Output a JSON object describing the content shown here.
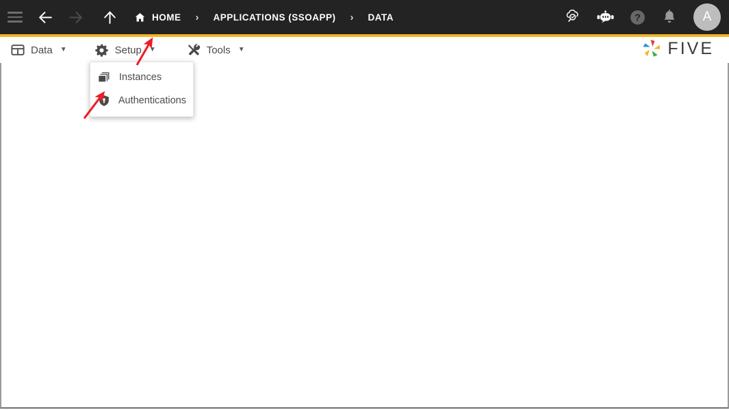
{
  "topbar": {
    "menu_button": "menu",
    "back_button": "back",
    "forward_button": "forward",
    "up_button": "up",
    "breadcrumbs": [
      {
        "label": "HOME",
        "icon": "home-icon"
      },
      {
        "label": "APPLICATIONS (SSOAPP)",
        "icon": ""
      },
      {
        "label": "DATA",
        "icon": ""
      }
    ],
    "separator": "›",
    "actions": [
      {
        "name": "cloud-search-icon",
        "title": "cloud-search"
      },
      {
        "name": "chatbot-icon",
        "title": "chatbot"
      },
      {
        "name": "help-icon",
        "title": "help",
        "glyph": "?"
      },
      {
        "name": "notifications-bell-icon",
        "title": "notifications"
      }
    ],
    "avatar_initial": "A"
  },
  "menubar": {
    "items": [
      {
        "label": "Data",
        "icon": "table-grid-icon",
        "caret": "▼"
      },
      {
        "label": "Setup",
        "icon": "gear-icon",
        "caret": "▼"
      },
      {
        "label": "Tools",
        "icon": "tools-icon",
        "caret": "▼"
      }
    ]
  },
  "logo": {
    "text": "FIVE",
    "mark": "five-star-logo",
    "colors": [
      "#2F8FD6",
      "#E03A3E",
      "#F7B32B",
      "#3DA94B"
    ]
  },
  "dropdown": {
    "open_for": "Setup",
    "items": [
      {
        "label": "Instances",
        "icon": "layers-icon"
      },
      {
        "label": "Authentications",
        "icon": "shield-lock-icon"
      }
    ]
  },
  "annotations": {
    "arrow_color": "#EE1C25",
    "arrows": [
      {
        "name": "arrow-to-setup-caret",
        "points_to": "Setup dropdown caret"
      },
      {
        "name": "arrow-to-authentications",
        "points_to": "Authentications menu item"
      }
    ]
  },
  "theme": {
    "topbar_bg": "#232323",
    "accent": "#F5B521",
    "content_bg": "#FFFFFF",
    "text_muted": "#4A4A4A"
  }
}
